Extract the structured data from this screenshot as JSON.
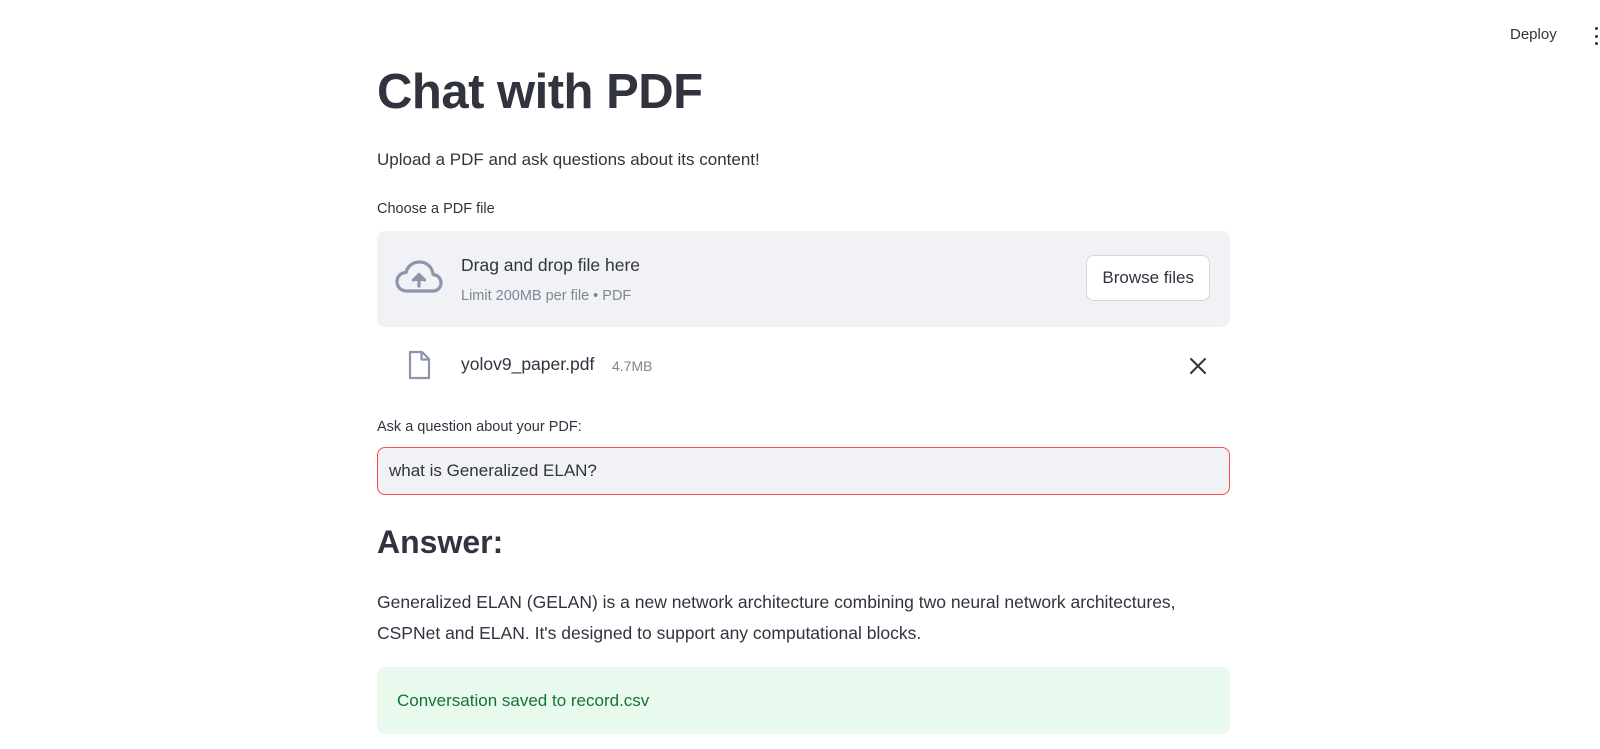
{
  "header": {
    "deploy_label": "Deploy",
    "menu_icon": "vertical-dots-icon"
  },
  "main": {
    "title": "Chat with PDF",
    "subtitle": "Upload a PDF and ask questions about its content!"
  },
  "uploader": {
    "label": "Choose a PDF file",
    "drop_text": "Drag and drop file here",
    "limit_text": "Limit 200MB per file • PDF",
    "browse_label": "Browse files",
    "icon": "cloud-upload-icon"
  },
  "uploaded_file": {
    "name": "yolov9_paper.pdf",
    "size": "4.7MB",
    "icon": "file-icon"
  },
  "question": {
    "label": "Ask a question about your PDF:",
    "value": "what is Generalized ELAN?"
  },
  "answer": {
    "heading": "Answer:",
    "text": "Generalized ELAN (GELAN) is a new network architecture combining two neural network architectures, CSPNet and ELAN. It's designed to support any computational blocks."
  },
  "status": {
    "success_message": "Conversation saved to record.csv"
  },
  "colors": {
    "text": "#31333f",
    "muted": "#808495",
    "panel": "#f0f2f6",
    "focus_border": "#ff4b4b",
    "success_bg": "#e8f9ee",
    "success_text": "#177233"
  }
}
